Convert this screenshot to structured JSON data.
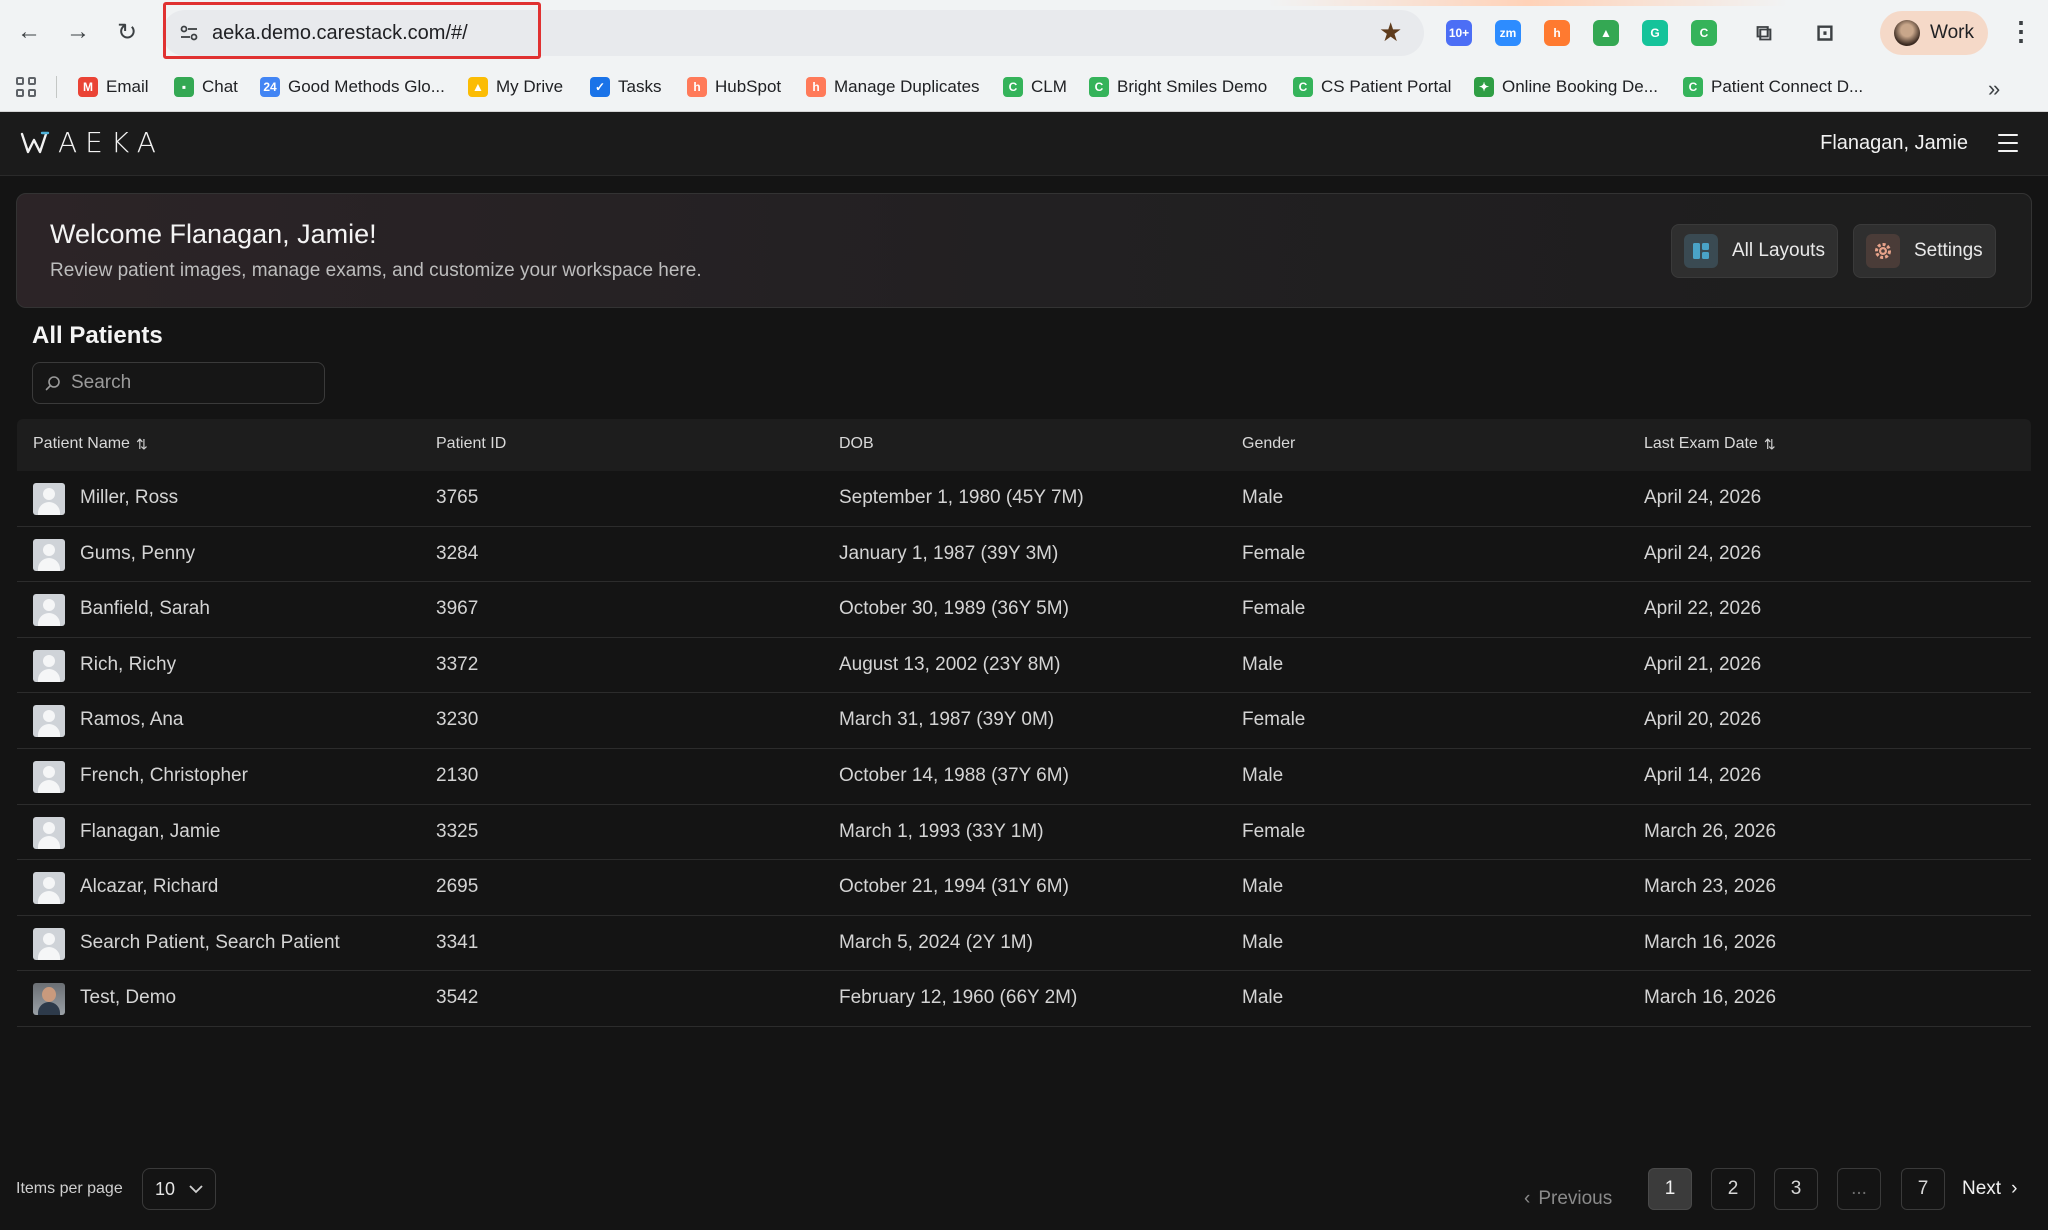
{
  "browser": {
    "url": "aeka.demo.carestack.com/#/",
    "profile_label": "Work",
    "extensions": [
      {
        "name": "calendar-ext-icon",
        "text": "10+",
        "color": "#4c6ef5"
      },
      {
        "name": "zoom-ext-icon",
        "text": "zm",
        "color": "#2d8cff"
      },
      {
        "name": "hubspot-ext-icon",
        "text": "h",
        "color": "#ff7a30"
      },
      {
        "name": "drive-ext-icon",
        "text": "▲",
        "color": "#34a853"
      },
      {
        "name": "grammarly-ext-icon",
        "text": "G",
        "color": "#15c39a"
      },
      {
        "name": "carestack-ext-icon",
        "text": "C",
        "color": "#35b35a"
      }
    ],
    "bookmarks": [
      {
        "label": "Email",
        "icon": "gmail-icon",
        "glyph": "M",
        "color": "#ea4335"
      },
      {
        "label": "Chat",
        "icon": "chat-icon",
        "glyph": "▪",
        "color": "#34a853"
      },
      {
        "label": "Good Methods Glo...",
        "icon": "calendar-icon",
        "glyph": "24",
        "color": "#4285f4"
      },
      {
        "label": "My Drive",
        "icon": "drive-icon",
        "glyph": "▲",
        "color": "#fbbc04"
      },
      {
        "label": "Tasks",
        "icon": "tasks-icon",
        "glyph": "✓",
        "color": "#1a73e8"
      },
      {
        "label": "HubSpot",
        "icon": "hubspot-icon",
        "glyph": "h",
        "color": "#ff7a59"
      },
      {
        "label": "Manage Duplicates",
        "icon": "hubspot-icon",
        "glyph": "h",
        "color": "#ff7a59"
      },
      {
        "label": "CLM",
        "icon": "carestack-icon",
        "glyph": "C",
        "color": "#35b35a"
      },
      {
        "label": "Bright Smiles Demo",
        "icon": "carestack-icon",
        "glyph": "C",
        "color": "#35b35a"
      },
      {
        "label": "CS Patient Portal",
        "icon": "carestack-icon",
        "glyph": "C",
        "color": "#35b35a"
      },
      {
        "label": "Online Booking De...",
        "icon": "booking-icon",
        "glyph": "✦",
        "color": "#2f9e44"
      },
      {
        "label": "Patient Connect D...",
        "icon": "carestack-icon",
        "glyph": "C",
        "color": "#35b35a"
      }
    ]
  },
  "app": {
    "logo_text": "AEKA",
    "user_name": "Flanagan, Jamie"
  },
  "welcome": {
    "title": "Welcome Flanagan, Jamie!",
    "subtitle": "Review patient images, manage exams, and customize your workspace here.",
    "layouts_label": "All Layouts",
    "settings_label": "Settings",
    "layouts_color": "#4aa3c7",
    "settings_color": "#e8a38a"
  },
  "patients": {
    "title": "All Patients",
    "search_placeholder": "Search",
    "columns": {
      "name": "Patient Name",
      "id": "Patient ID",
      "dob": "DOB",
      "gender": "Gender",
      "last_exam": "Last Exam Date"
    },
    "rows": [
      {
        "name": "Miller, Ross",
        "id": "3765",
        "dob": "September 1, 1980 (45Y 7M)",
        "gender": "Male",
        "last_exam": "April 24, 2026",
        "photo": false
      },
      {
        "name": "Gums, Penny",
        "id": "3284",
        "dob": "January 1, 1987 (39Y 3M)",
        "gender": "Female",
        "last_exam": "April 24, 2026",
        "photo": false
      },
      {
        "name": "Banfield, Sarah",
        "id": "3967",
        "dob": "October 30, 1989 (36Y 5M)",
        "gender": "Female",
        "last_exam": "April 22, 2026",
        "photo": false
      },
      {
        "name": "Rich, Richy",
        "id": "3372",
        "dob": "August 13, 2002 (23Y 8M)",
        "gender": "Male",
        "last_exam": "April 21, 2026",
        "photo": false
      },
      {
        "name": "Ramos, Ana",
        "id": "3230",
        "dob": "March 31, 1987 (39Y 0M)",
        "gender": "Female",
        "last_exam": "April 20, 2026",
        "photo": false
      },
      {
        "name": "French, Christopher",
        "id": "2130",
        "dob": "October 14, 1988 (37Y 6M)",
        "gender": "Male",
        "last_exam": "April 14, 2026",
        "photo": false
      },
      {
        "name": "Flanagan, Jamie",
        "id": "3325",
        "dob": "March 1, 1993 (33Y 1M)",
        "gender": "Female",
        "last_exam": "March 26, 2026",
        "photo": false
      },
      {
        "name": "Alcazar, Richard",
        "id": "2695",
        "dob": "October 21, 1994 (31Y 6M)",
        "gender": "Male",
        "last_exam": "March 23, 2026",
        "photo": false
      },
      {
        "name": "Search Patient, Search Patient",
        "id": "3341",
        "dob": "March 5, 2024 (2Y 1M)",
        "gender": "Male",
        "last_exam": "March 16, 2026",
        "photo": false
      },
      {
        "name": "Test, Demo",
        "id": "3542",
        "dob": "February 12, 1960 (66Y 2M)",
        "gender": "Male",
        "last_exam": "March 16, 2026",
        "photo": true
      }
    ]
  },
  "pagination": {
    "items_per_page_label": "Items per page",
    "items_per_page_value": "10",
    "previous_label": "Previous",
    "next_label": "Next",
    "pages": [
      "1",
      "2",
      "3",
      "...",
      "7"
    ],
    "current_page": "1"
  }
}
